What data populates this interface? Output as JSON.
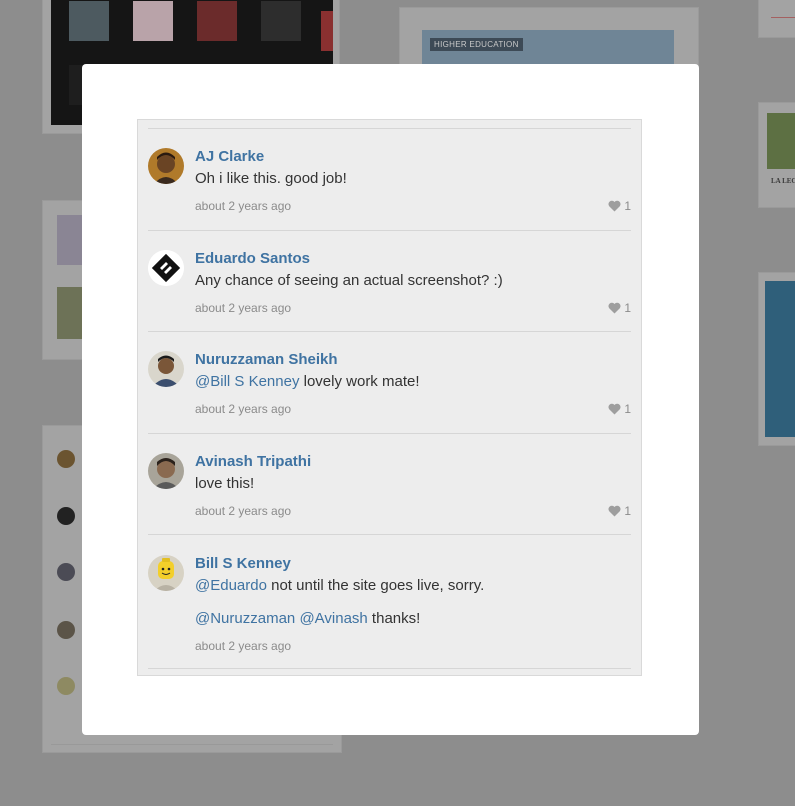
{
  "background": {
    "left_badge": "HIGHER EDUCATION",
    "right_card_text": "LA LEC"
  },
  "comments": [
    {
      "author": "AJ Clarke",
      "avatar": "avatar-photo-icon",
      "text": "Oh i like this. good job!",
      "time": "about 2 years ago",
      "likes": "1"
    },
    {
      "author": "Eduardo Santos",
      "avatar": "diamond-logo-icon",
      "text": "Any chance of seeing an actual screenshot? :)",
      "time": "about 2 years ago",
      "likes": "1"
    },
    {
      "author": "Nuruzzaman Sheikh",
      "avatar": "avatar-photo-icon",
      "mention": "@Bill S Kenney",
      "text": " lovely work mate!",
      "time": "about 2 years ago",
      "likes": "1"
    },
    {
      "author": "Avinash Tripathi",
      "avatar": "avatar-photo-icon",
      "text": "love this!",
      "time": "about 2 years ago",
      "likes": "1"
    },
    {
      "author": "Bill S Kenney",
      "avatar": "lego-avatar-icon",
      "mention": "@Eduardo",
      "text": " not until the site goes live, sorry.",
      "mention2a": "@Nuruzzaman",
      "mention2b": "@Avinash",
      "text2": " thanks!",
      "time": "about 2 years ago"
    }
  ],
  "colors": {
    "author": "#3f73a2",
    "overlay": "#8d8d8d",
    "panel": "#ededed"
  }
}
